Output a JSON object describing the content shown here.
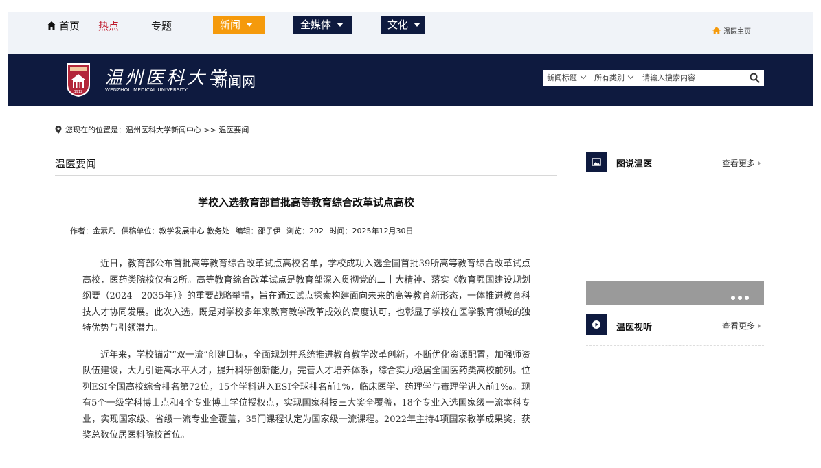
{
  "nav": {
    "home": "首页",
    "hot": "热点",
    "topic": "专题",
    "news": "新闻",
    "media": "全媒体",
    "culture": "文化",
    "homepage": "温医主页",
    "colors": {
      "news_bg": "#f59a0c",
      "dark_bg": "#0e1a3f",
      "hot_text": "#c0192b"
    }
  },
  "header": {
    "logo_cn": "温州医科大学",
    "logo_en": "WENZHOU MEDICAL UNIVERSITY",
    "site_name": "新闻网",
    "emblem_year": "1912"
  },
  "search": {
    "field": "新闻标题",
    "type": "所有类别",
    "placeholder": "请输入搜索内容"
  },
  "breadcrumb": {
    "prefix": "您现在的位置是：",
    "path": "温州医科大学新闻中心 >> 温医要闻"
  },
  "section": {
    "title": "温医要闻"
  },
  "article": {
    "title": "学校入选教育部首批高等教育综合改革试点高校",
    "meta": {
      "author": "作者：金素凡",
      "unit": "供稿单位：教学发展中心 教务处",
      "editor": "编辑：邵子伊",
      "views": "浏览：202",
      "time": "时间：2025年12月30日"
    },
    "paragraphs": [
      "近日，教育部公布首批高等教育综合改革试点高校名单，学校成功入选全国首批39所高等教育综合改革试点高校，医药类院校仅有2所。高等教育综合改革试点是教育部深入贯彻党的二十大精神、落实《教育强国建设规划纲要（2024—2035年）》的重要战略举措，旨在通过试点探索构建面向未来的高等教育新形态，一体推进教育科技人才协同发展。此次入选，既是对学校多年来教育教学改革成效的高度认可，也彰显了学校在医学教育领域的独特优势与引领潜力。",
      "近年来，学校锚定“双一流”创建目标，全面规划并系统推进教育教学改革创新，不断优化资源配置，加强师资队伍建设，大力引进高水平人才，提升科研创新能力，完善人才培养体系，综合实力稳居全国医药类高校前列。位列ESI全国高校综合排名第72位，15个学科进入ESI全球排名前1%，临床医学、药理学与毒理学进入前1‰。现有5个一级学科博士点和4个专业博士学位授权点，实现国家科技三大奖全覆盖，18个专业入选国家级一流本科专业，实现国家级、省级一流专业全覆盖，35门课程认定为国家级一流课程。2022年主持4项国家教学成果奖，获奖总数位居医科院校首位。"
    ]
  },
  "sidebar": {
    "photo": {
      "title": "图说温医",
      "more": "查看更多"
    },
    "video": {
      "title": "温医视听",
      "more": "查看更多"
    }
  }
}
